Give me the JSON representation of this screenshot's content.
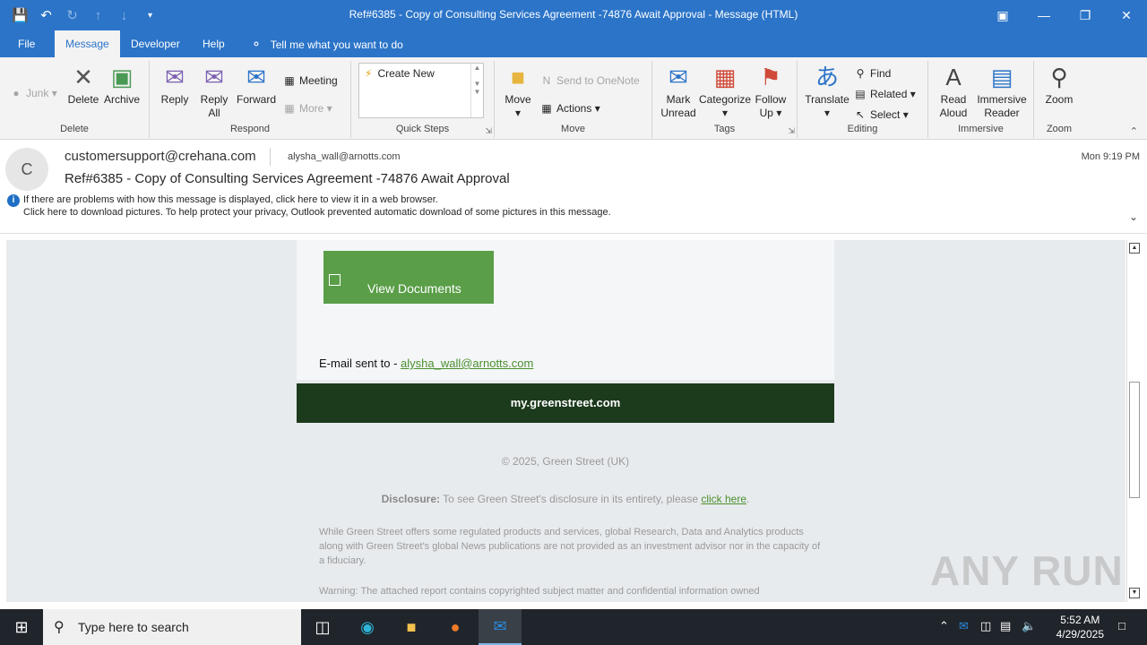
{
  "titlebar": {
    "title": "Ref#6385 - Copy of Consulting Services Agreement -74876 Await Approval  -  Message (HTML)"
  },
  "menu": {
    "tabs": [
      "File",
      "Message",
      "Developer",
      "Help"
    ],
    "active": "Message",
    "tell_me": "Tell me what you want to do"
  },
  "ribbon": {
    "junk": "Junk",
    "delete": "Delete",
    "archive": "Archive",
    "group_delete": "Delete",
    "reply": "Reply",
    "reply_all_1": "Reply",
    "reply_all_2": "All",
    "forward": "Forward",
    "meeting": "Meeting",
    "more": "More",
    "group_respond": "Respond",
    "quick_steps_item": "Create New",
    "group_quick_steps": "Quick Steps",
    "move": "Move",
    "send_onenote": "Send to OneNote",
    "actions": "Actions",
    "group_move": "Move",
    "mark_unread_1": "Mark",
    "mark_unread_2": "Unread",
    "categorize": "Categorize",
    "follow_up_1": "Follow",
    "follow_up_2": "Up",
    "group_tags": "Tags",
    "translate": "Translate",
    "find": "Find",
    "related": "Related",
    "select": "Select",
    "group_editing": "Editing",
    "read_aloud_1": "Read",
    "read_aloud_2": "Aloud",
    "immersive_1": "Immersive",
    "immersive_2": "Reader",
    "group_immersive": "Immersive",
    "zoom": "Zoom",
    "group_zoom": "Zoom"
  },
  "message": {
    "avatar_initial": "C",
    "from": "customersupport@crehana.com",
    "to": "alysha_wall@arnotts.com",
    "date": "Mon 9:19 PM",
    "subject": "Ref#6385 - Copy of Consulting Services Agreement -74876 Await Approval",
    "info_line1": "If there are problems with how this message is displayed, click here to view it in a web browser.",
    "info_line2": "Click here to download pictures. To help protect your privacy, Outlook prevented automatic download of some pictures in this message."
  },
  "email_body": {
    "view_documents": "View Documents",
    "sent_to_label": "E-mail sent to - ",
    "sent_to_email": "alysha_wall@arnotts.com",
    "banner": "my.greenstreet.com",
    "copyright": "© 2025, Green Street (UK)",
    "disclosure_label": "Disclosure:",
    "disclosure_text": " To see Green Street's disclosure in its entirety, please ",
    "disclosure_link": "click here",
    "disclosure_end": ".",
    "paragraph": "While Green Street offers some regulated products and services, global Research, Data and Analytics products along with Green Street's global News publications are not provided as an investment advisor nor in the capacity of a fiduciary.",
    "warning": "Warning: The attached report contains copyrighted subject matter and confidential information owned"
  },
  "watermark": "ANY RUN",
  "taskbar": {
    "search_placeholder": "Type here to search",
    "time": "5:52 AM",
    "date": "4/29/2025"
  }
}
